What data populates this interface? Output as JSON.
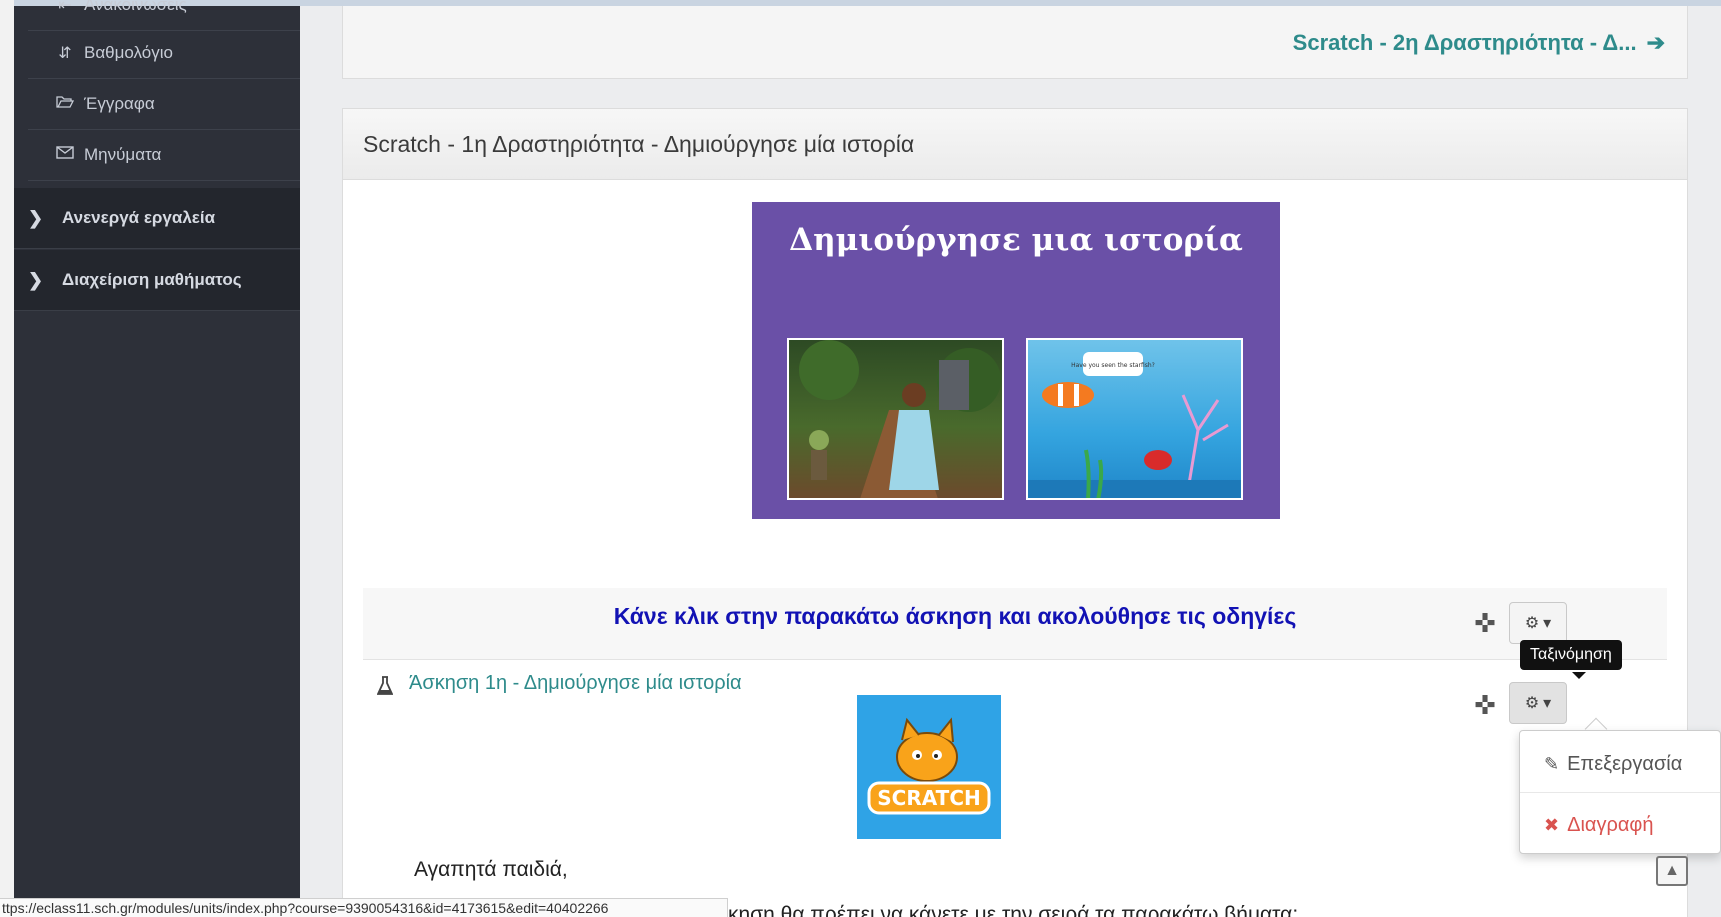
{
  "sidebar": {
    "partial_item": "Ανακοινώσεις",
    "items": [
      {
        "label": "Βαθμολόγιο",
        "icon": "sort-numeric-icon"
      },
      {
        "label": "Έγγραφα",
        "icon": "folder-open-icon"
      },
      {
        "label": "Μηνύματα",
        "icon": "envelope-icon"
      }
    ],
    "groups": [
      {
        "label": "Ανενεργά εργαλεία"
      },
      {
        "label": "Διαχείριση μαθήματος"
      }
    ]
  },
  "navigation": {
    "next_unit": "Scratch - 2η Δραστηριότητα - Δ..."
  },
  "unit": {
    "title": "Scratch - 1η Δραστηριότητα - Δημιούργησε μία ιστορία",
    "banner_title": "Δημιούργησε μια ιστορία",
    "label_text": "Κάνε κλικ στην παρακάτω άσκηση και ακολούθησε τις οδηγίες",
    "activity_link": "Άσκηση 1η - Δημιούργησε μία ιστορία",
    "scratch_logo_text": "SCRATCH",
    "speech_bubble": "Have you seen the starfish?",
    "greeting": "Αγαπητά παιδιά,",
    "partial_text": "κηση θα πρέπει να κάνετε με την σειρά τα παρακάτω βήματα:"
  },
  "tooltip": "Ταξινόμηση",
  "dropdown": {
    "edit_label": "Επεξεργασία",
    "delete_label": "Διαγραφή"
  },
  "statusbar_url": "ttps://eclass11.sch.gr/modules/units/index.php?course=9390054316&id=4173615&edit=40402266",
  "colors": {
    "sidebar_bg": "#2d3039",
    "link_teal": "#2e8b8b",
    "label_blue": "#1212b4",
    "banner_purple": "#6a50a7",
    "delete_red": "#d9534f"
  }
}
